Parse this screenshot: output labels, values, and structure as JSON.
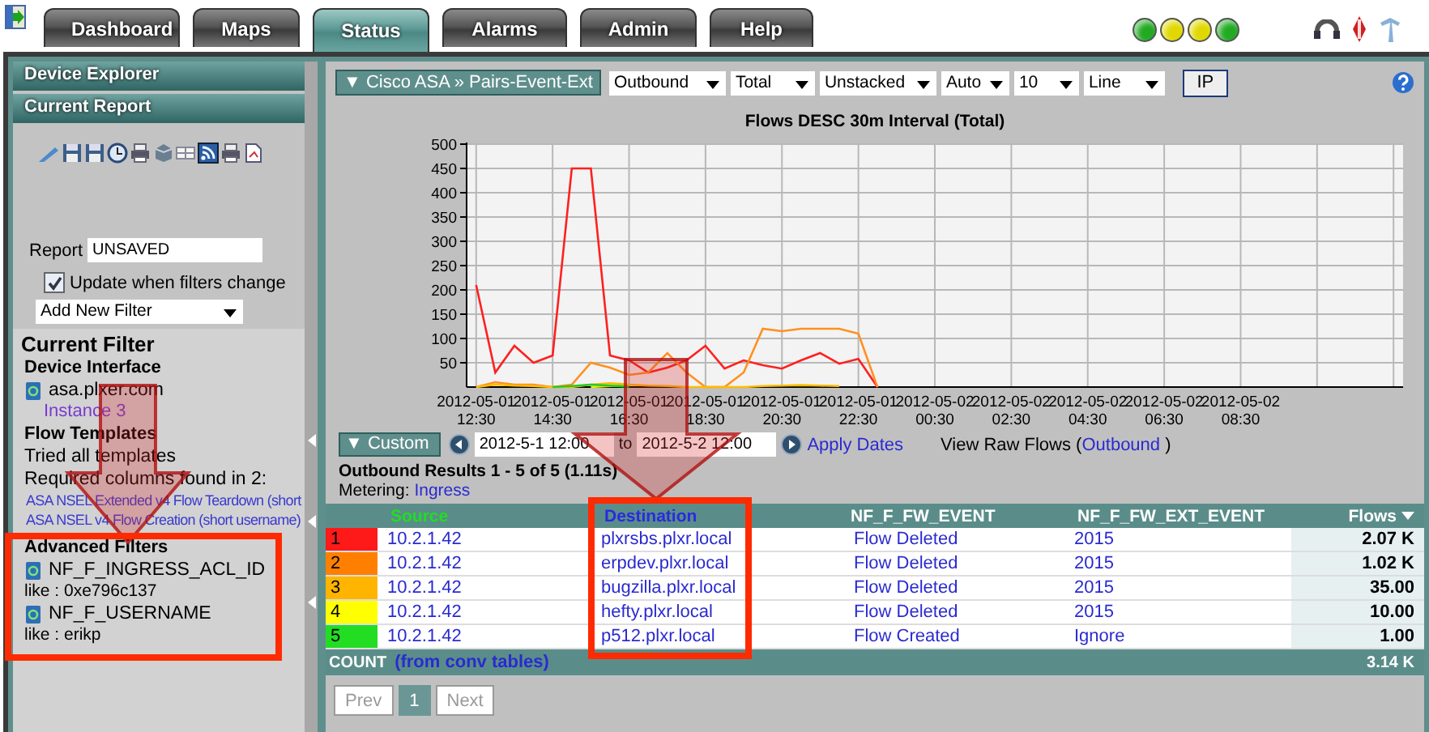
{
  "tabs": [
    {
      "label": "Dashboard",
      "selected": false
    },
    {
      "label": "Maps",
      "selected": false
    },
    {
      "label": "Status",
      "selected": true
    },
    {
      "label": "Alarms",
      "selected": false
    },
    {
      "label": "Admin",
      "selected": false
    },
    {
      "label": "Help",
      "selected": false
    }
  ],
  "status_lights": [
    {
      "color": "#22aa22"
    },
    {
      "color": "#e0d800"
    },
    {
      "color": "#e0d800"
    },
    {
      "color": "#22aa22"
    }
  ],
  "sidebar": {
    "sections": [
      "Device Explorer",
      "Current Report"
    ],
    "report_label": "Report",
    "report_name": "UNSAVED",
    "auto_update": {
      "label": "Update when filters change",
      "checked": true
    },
    "add_filter": "Add New Filter",
    "current_filter": {
      "title": "Current Filter",
      "device_heading": "Device Interface",
      "device": "asa.plxer.com",
      "instance": "Instance 3",
      "templates_heading": "Flow Templates",
      "templates_status": "Tried all templates",
      "columns_note": "Required columns found in 2:",
      "templates": [
        "ASA NSEL Extended v4 Flow Teardown (short",
        "ASA NSEL v4 Flow Creation (short username)"
      ],
      "advanced_heading": "Advanced Filters",
      "filters": [
        {
          "field": "NF_F_INGRESS_ACL_ID",
          "condition": "like : 0xe796c137"
        },
        {
          "field": "NF_F_USERNAME",
          "condition": "like : erikp"
        }
      ]
    }
  },
  "report": {
    "breadcrumb": "▼ Cisco ASA » Pairs-Event-Ext",
    "selectors": [
      "Outbound",
      "Total",
      "Unstacked",
      "Auto",
      "10",
      "Line"
    ],
    "ip_button": "IP",
    "chart_data": {
      "type": "line",
      "title": "Flows DESC 30m Interval (Total)",
      "categories": [
        "2012-05-01 12:30",
        null,
        null,
        null,
        "2012-05-01 14:30",
        null,
        null,
        null,
        "2012-05-01 16:30",
        null,
        null,
        null,
        "2012-05-01 18:30",
        null,
        null,
        null,
        "2012-05-01 20:30",
        null,
        null,
        null,
        "2012-05-01 22:30",
        null,
        null,
        null,
        "2012-05-02 00:30",
        null,
        null,
        null,
        "2012-05-02 02:30",
        null,
        null,
        null,
        "2012-05-02 04:30",
        null,
        null,
        null,
        "2012-05-02 06:30",
        null,
        null,
        null,
        "2012-05-02 08:30",
        null,
        null,
        null,
        null,
        null,
        null,
        null,
        null
      ],
      "series": [
        {
          "color": "#ff2020",
          "values": [
            210,
            30,
            85,
            50,
            65,
            450,
            450,
            65,
            55,
            30,
            40,
            55,
            85,
            38,
            55,
            45,
            38,
            55,
            70,
            48,
            58,
            0,
            null,
            null,
            null,
            null,
            null,
            null,
            null,
            null,
            null,
            null,
            null,
            null,
            null,
            null,
            null,
            null,
            null,
            null,
            null,
            null,
            null,
            null,
            null,
            null,
            null,
            null,
            null
          ]
        },
        {
          "color": "#ff9020",
          "values": [
            0,
            10,
            5,
            5,
            0,
            5,
            50,
            40,
            25,
            30,
            70,
            30,
            0,
            0,
            30,
            120,
            115,
            120,
            120,
            120,
            110,
            0,
            null,
            null,
            null,
            null,
            null,
            null,
            null,
            null,
            null,
            null,
            null,
            null,
            null,
            null,
            null,
            null,
            null,
            null,
            null,
            null,
            null,
            null,
            null,
            null,
            null,
            null,
            null
          ]
        },
        {
          "color": "#ffbb00",
          "values": [
            0,
            5,
            3,
            2,
            0,
            0,
            5,
            8,
            5,
            3,
            2,
            0,
            0,
            0,
            0,
            2,
            3,
            4,
            3,
            2,
            null,
            null,
            null,
            null,
            null,
            null,
            null,
            null,
            null,
            null,
            null,
            null,
            null,
            null,
            null,
            null,
            null,
            null,
            null,
            null,
            null,
            null,
            null,
            null,
            null,
            null,
            null,
            null,
            null
          ]
        },
        {
          "color": "#e8e800",
          "values": [
            null,
            null,
            null,
            null,
            null,
            null,
            0,
            2,
            3,
            null,
            null,
            null,
            null,
            null,
            null,
            null,
            null,
            null,
            null,
            null,
            null,
            null,
            null,
            null,
            null,
            null,
            null,
            null,
            null,
            null,
            null,
            null,
            null,
            null,
            null,
            null,
            null,
            null,
            null,
            null,
            null,
            null,
            null,
            null,
            null,
            null,
            null,
            null,
            null
          ]
        },
        {
          "color": "#22cc22",
          "values": [
            null,
            null,
            null,
            null,
            0,
            2,
            5,
            3,
            1,
            null,
            null,
            null,
            null,
            null,
            null,
            null,
            null,
            null,
            null,
            null,
            null,
            null,
            null,
            null,
            null,
            null,
            null,
            null,
            null,
            null,
            null,
            null,
            null,
            null,
            null,
            null,
            null,
            null,
            null,
            null,
            null,
            null,
            null,
            null,
            null,
            null,
            null,
            null,
            null
          ]
        }
      ],
      "ylim": [
        0,
        500
      ],
      "grid": true,
      "yticks": [
        50,
        100,
        150,
        200,
        250,
        300,
        350,
        400,
        450,
        500
      ]
    },
    "time_range": {
      "mode": "▼ Custom",
      "from": "2012-5-1 12:00",
      "to_label": "to",
      "to": "2012-5-2 12:00",
      "apply": "Apply Dates",
      "raw_flows": "View Raw Flows (",
      "raw_flows_link": "Outbound",
      "raw_flows_end": ")"
    },
    "results": {
      "summary": "Outbound Results 1 - 5 of 5 (1.11s)",
      "metering_label": "Metering:",
      "metering": "Ingress"
    },
    "table": {
      "columns": [
        {
          "label": "Source",
          "color": "#22dd22"
        },
        {
          "label": "Destination",
          "color": "#2a2ae0"
        },
        {
          "label": "NF_F_FW_EVENT"
        },
        {
          "label": "NF_F_FW_EXT_EVENT"
        },
        {
          "label": "Flows",
          "sorted": true
        }
      ],
      "rows": [
        {
          "rank": "1",
          "color": "#ff1a1a",
          "source": "10.2.1.42",
          "destination": "plxrsbs.plxr.local",
          "event": "Flow Deleted",
          "ext_event": "2015",
          "flows": "2.07 K"
        },
        {
          "rank": "2",
          "color": "#ff8000",
          "source": "10.2.1.42",
          "destination": "erpdev.plxr.local",
          "event": "Flow Deleted",
          "ext_event": "2015",
          "flows": "1.02 K"
        },
        {
          "rank": "3",
          "color": "#ffb400",
          "source": "10.2.1.42",
          "destination": "bugzilla.plxr.local",
          "event": "Flow Deleted",
          "ext_event": "2015",
          "flows": "35.00"
        },
        {
          "rank": "4",
          "color": "#ffff00",
          "source": "10.2.1.42",
          "destination": "hefty.plxr.local",
          "event": "Flow Deleted",
          "ext_event": "2015",
          "flows": "10.00"
        },
        {
          "rank": "5",
          "color": "#22dd22",
          "source": "10.2.1.42",
          "destination": "p512.plxr.local",
          "event": "Flow Created",
          "ext_event": "Ignore",
          "flows": "1.00"
        }
      ],
      "footer": {
        "label": "COUNT",
        "note": "(from conv tables)",
        "total": "3.14 K"
      }
    },
    "pagination": {
      "prev": {
        "label": "Prev",
        "disabled": true
      },
      "pages": [
        {
          "label": "1",
          "selected": true
        }
      ],
      "next": {
        "label": "Next",
        "disabled": true
      }
    }
  },
  "annotations": [
    {
      "kind": "arrow"
    },
    {
      "kind": "box"
    },
    {
      "kind": "arrow"
    },
    {
      "kind": "box"
    }
  ]
}
